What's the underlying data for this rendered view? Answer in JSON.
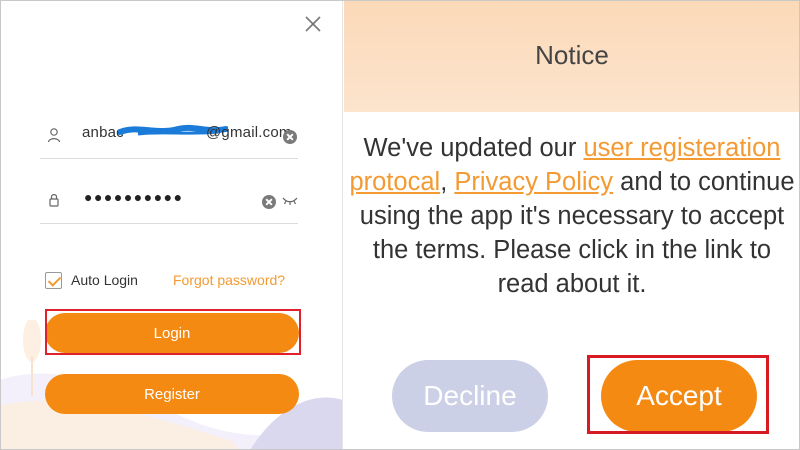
{
  "login": {
    "email_value": "anbac                @gmail.com",
    "email_visible_suffix": "@gmail.com",
    "email_visible_prefix": "anbac",
    "password_value": "●●●●●●●●●●",
    "auto_login_label": "Auto Login",
    "auto_login_checked": true,
    "forgot_password_label": "Forgot password?",
    "login_button": "Login",
    "register_button": "Register"
  },
  "notice": {
    "title": "Notice",
    "line1_text": "We've updated our ",
    "link_user_protocol": "user registeration protocal",
    "comma": ", ",
    "link_privacy": "Privacy Policy",
    "line_rest": " and to continue using the app it's necessary to accept the terms. Please click in the link to read about it.",
    "decline_button": "Decline",
    "accept_button": "Accept"
  },
  "colors": {
    "accent": "#f48a12",
    "link": "#f39a32",
    "decline_bg": "#ccd0e6",
    "header_bg": "#fbd9b8",
    "highlight_frame": "#e0202a"
  },
  "icons": {
    "close": "close-icon",
    "user": "user-icon",
    "lock": "lock-icon",
    "clear": "clear-icon",
    "eye": "eye-hidden-icon",
    "check": "checkmark-icon"
  }
}
